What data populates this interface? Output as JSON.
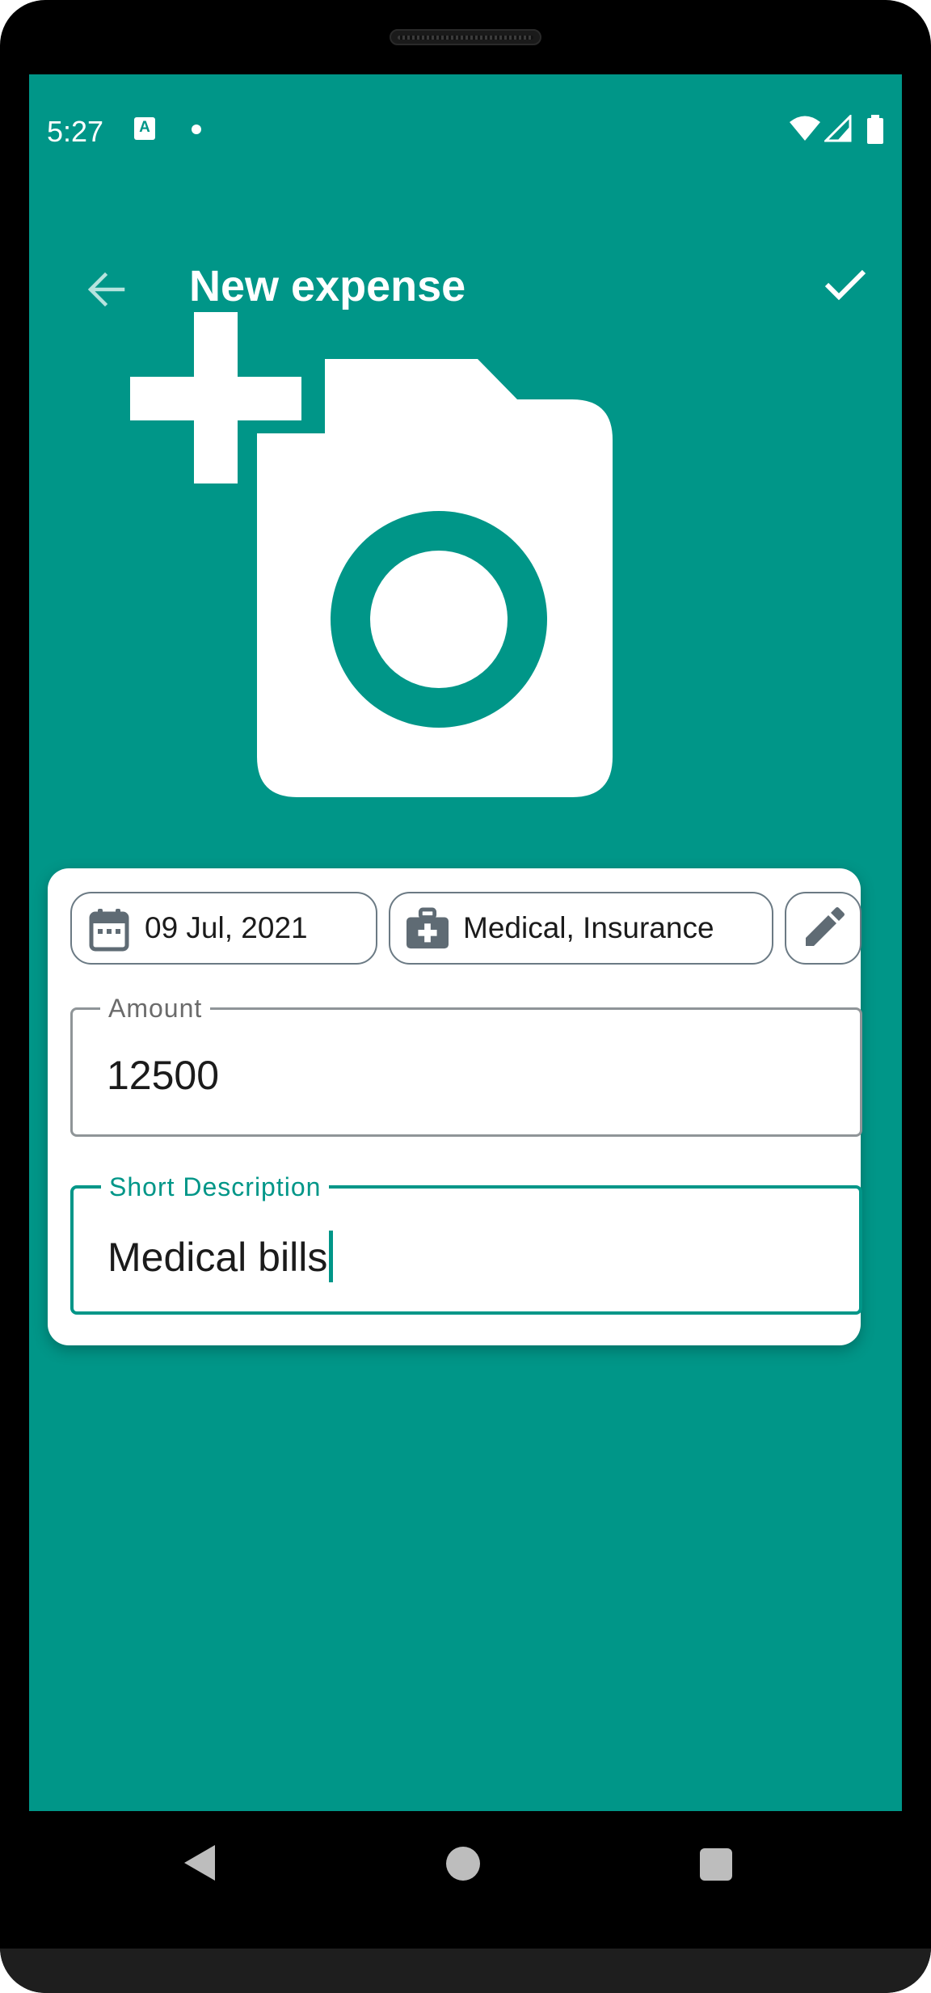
{
  "status_bar": {
    "time": "5:27",
    "left_icons": [
      "a-notification-icon",
      "dot-icon"
    ],
    "right_icons": [
      "wifi-icon",
      "signal-icon",
      "battery-icon"
    ]
  },
  "app_bar": {
    "back_icon": "arrow-left-icon",
    "title": "New expense",
    "save_icon": "check-icon"
  },
  "photo": {
    "icon": "add-a-photo-icon"
  },
  "form": {
    "date_chip": {
      "icon": "calendar-icon",
      "label": "09 Jul, 2021"
    },
    "category_chip": {
      "icon": "medical-bag-icon",
      "label": "Medical, Insurance"
    },
    "edit_chip": {
      "icon": "pencil-icon"
    },
    "amount": {
      "label": "Amount",
      "value": "12500"
    },
    "description": {
      "label": "Short Description",
      "value": "Medical bills"
    }
  },
  "nav_bar": {
    "items": [
      "back-triangle-icon",
      "home-circle-icon",
      "recents-square-icon"
    ]
  },
  "colors": {
    "primary": "#009688",
    "chip_border": "#6b7a84",
    "icon_gray": "#5f6b74"
  }
}
